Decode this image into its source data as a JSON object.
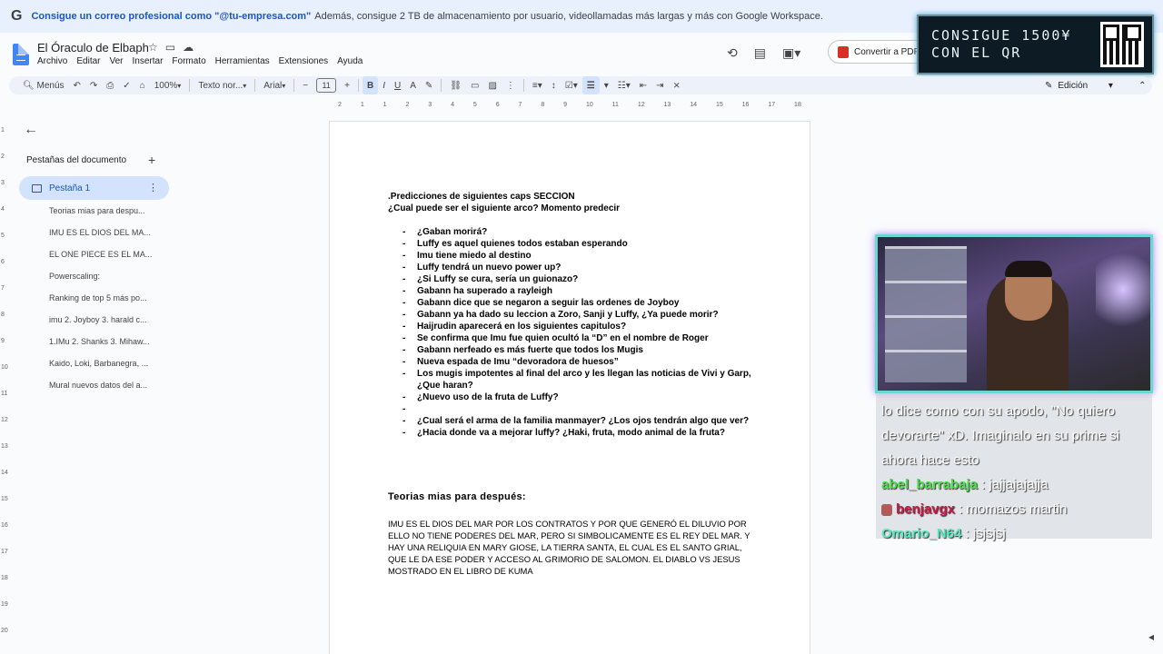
{
  "promo": {
    "brand_glyph": "G",
    "bold_text": "Consigue un correo profesional como \"@tu-empresa.com\"",
    "text": "Además, consigue 2 TB de almacenamiento por usuario, videollamadas más largas y más con Google Workspace."
  },
  "header": {
    "doc_title": "El Óraculo de Elbaph",
    "menu": [
      "Archivo",
      "Editar",
      "Ver",
      "Insertar",
      "Formato",
      "Herramientas",
      "Extensiones",
      "Ayuda"
    ],
    "pdf_button": "Convertir a PDF"
  },
  "overlay": {
    "qr_line1": "CONSIGUE 1500¥",
    "qr_line2": "CON EL QR"
  },
  "toolbar": {
    "menus_label": "Menús",
    "zoom": "100%",
    "style": "Texto nor...",
    "font": "Arial",
    "font_size": "11",
    "mode": "Edición"
  },
  "ruler": {
    "ticks": [
      "2",
      "1",
      "1",
      "2",
      "3",
      "4",
      "5",
      "6",
      "7",
      "8",
      "9",
      "10",
      "11",
      "12",
      "13",
      "14",
      "15",
      "16",
      "17",
      "18"
    ],
    "left_ticks": [
      "1",
      "2",
      "3",
      "4",
      "5",
      "6",
      "7",
      "8",
      "9",
      "10",
      "11",
      "12",
      "13",
      "14",
      "15",
      "16",
      "17",
      "18",
      "19",
      "20"
    ]
  },
  "sidebar": {
    "heading": "Pestañas del documento",
    "active_tab": "Pestaña 1",
    "outline": [
      "Teorias mias para despu...",
      "IMU ES EL DIOS DEL MA...",
      "EL ONE PIECE ES EL MA...",
      "Powerscaling:",
      "Ranking de top 5 más po...",
      "imu 2. Joyboy 3. harald c...",
      "1.IMu 2. Shanks 3. Mihaw...",
      "Kaido, Loki, Barbanegra, ...",
      "Mural nuevos datos del a..."
    ]
  },
  "document": {
    "line1": ".Predicciones de siguientes caps SECCION",
    "line2": "¿Cual puede ser el siguiente arco? Momento predecir",
    "bullets": [
      "¿Gaban morirá?",
      "Luffy es aquel quienes todos estaban esperando",
      "Imu tiene miedo al destino",
      "Luffy tendrá un nuevo power up?",
      "¿Si Luffy se cura, sería un guionazo?",
      "Gabann ha superado a rayleigh",
      "Gabann dice que se negaron a seguir las ordenes de Joyboy",
      "Gabann ya ha dado su leccion a Zoro, Sanji y Luffy, ¿Ya puede morir?",
      "Haijrudin aparecerá en los siguientes capitulos?",
      "Se confirma que Imu fue quien ocultó la “D” en el nombre de Roger",
      "Gabann nerfeado es más fuerte que todos los Mugis",
      "Nueva espada de Imu “devoradora de huesos”",
      "Los mugis impotentes al final del arco y les llegan las noticias de Vivi y Garp, ¿Que haran?",
      "¿Nuevo uso de la fruta de Luffy?",
      "",
      "¿Cual será el arma de la familia manmayer? ¿Los ojos tendrán algo que ver?",
      "¿Hacia donde va a mejorar luffy? ¿Haki, fruta, modo animal de la fruta?"
    ],
    "heading": "Teorias mias para después:",
    "paragraph": "IMU ES EL DIOS DEL MAR POR LOS CONTRATOS Y POR QUE GENERÓ EL DILUVIO POR ELLO NO TIENE PODERES DEL MAR, PERO SI SIMBOLICAMENTE ES EL REY DEL MAR. Y HAY UNA RELIQUIA EN MARY GIOSE, LA TIERRA SANTA, EL CUAL ES EL SANTO GRIAL, QUE LE DA ESE PODER Y ACCESO AL GRIMORIO DE SALOMON. EL DIABLO VS JESUS MOSTRADO EN EL LIBRO DE KUMA"
  },
  "chat": {
    "msg1": "lo dice como con su apodo, \"No quiero devorarte\" xD. Imaginalo en su prime si ahora hace esto",
    "user2": "abel_barrabaja",
    "msg2": " : jajjajajajja",
    "user3": "benjavgx",
    "msg3": " : momazos martin",
    "user4": "Omario_N64",
    "msg4": " : jsjsjsj"
  }
}
